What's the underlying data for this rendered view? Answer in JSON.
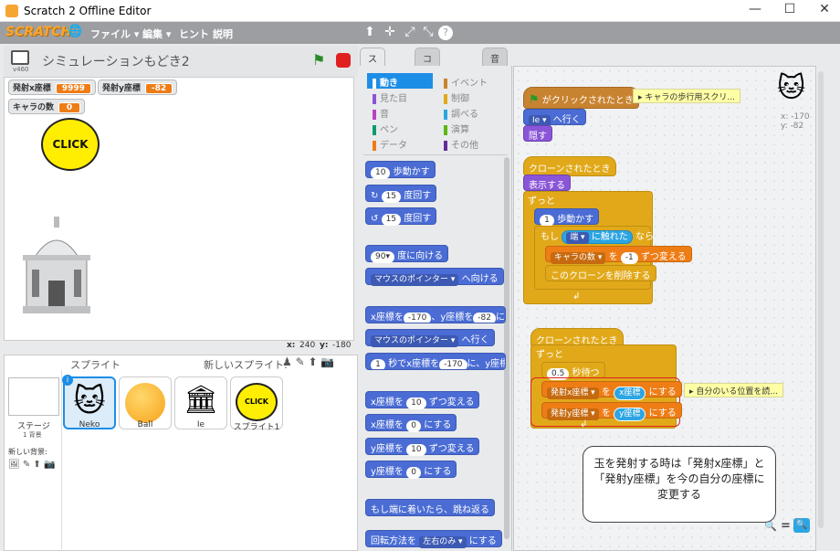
{
  "window": {
    "title": "Scratch 2 Offline Editor",
    "min": "—",
    "max": "☐",
    "close": "✕"
  },
  "menubar": {
    "logo": "SCRATCH",
    "items": [
      "ファイル ▾",
      "編集 ▾",
      "ヒント",
      "説明"
    ],
    "tools": [
      "⬆",
      "✛",
      "⤢",
      "⤡",
      "?"
    ]
  },
  "stage": {
    "title": "シミュレーションもどき2",
    "version": "v460",
    "monitors": [
      {
        "label": "発射x座標",
        "value": "9999"
      },
      {
        "label": "発射y座標",
        "value": "-82"
      },
      {
        "label": "キャラの数",
        "value": "0"
      }
    ],
    "click_text": "CLICK",
    "coords": {
      "x_label": "x:",
      "x": "240",
      "y_label": "y:",
      "y": "-180"
    }
  },
  "sprites": {
    "header": "スプライト",
    "new_label": "新しいスプライト:",
    "stage_label": "ステージ",
    "stage_sub": "1 背景",
    "new_bg": "新しい背景:",
    "items": [
      {
        "name": "Neko"
      },
      {
        "name": "Ball"
      },
      {
        "name": "Ie"
      },
      {
        "name": "スプライト1"
      }
    ]
  },
  "tabs": [
    "スクリプト",
    "コスチューム",
    "音"
  ],
  "categories": {
    "left": [
      {
        "label": "動き",
        "color": "#4a6cd4"
      },
      {
        "label": "見た目",
        "color": "#8a55d7"
      },
      {
        "label": "音",
        "color": "#bb42c3"
      },
      {
        "label": "ペン",
        "color": "#0e9a6c"
      },
      {
        "label": "データ",
        "color": "#ee7d16"
      }
    ],
    "right": [
      {
        "label": "イベント",
        "color": "#c88330"
      },
      {
        "label": "制御",
        "color": "#e1a91a"
      },
      {
        "label": "調べる",
        "color": "#2ca5e2"
      },
      {
        "label": "演算",
        "color": "#5cb712"
      },
      {
        "label": "その他",
        "color": "#632d99"
      }
    ]
  },
  "palette": {
    "move": {
      "n": "10",
      "t": "歩動かす"
    },
    "turn_r": {
      "n": "15",
      "t": "度回す"
    },
    "turn_l": {
      "n": "15",
      "t": "度回す"
    },
    "point": {
      "n": "90▾",
      "t": "度に向ける"
    },
    "toward": {
      "d": "マウスのポインター ▾",
      "t": "へ向ける"
    },
    "gotoxy": {
      "a": "x座標を",
      "x": "-170",
      "b": "、y座標を",
      "y": "-82",
      "c": "にす"
    },
    "goto": {
      "d": "マウスのポインター ▾",
      "t": "へ行く"
    },
    "glide": {
      "n": "1",
      "a": "秒でx座標を",
      "x": "-170",
      "b": "に、y座標を"
    },
    "changex": {
      "a": "x座標を",
      "n": "10",
      "b": "ずつ変える"
    },
    "setx": {
      "a": "x座標を",
      "n": "0",
      "b": "にする"
    },
    "changey": {
      "a": "y座標を",
      "n": "10",
      "b": "ずつ変える"
    },
    "sety": {
      "a": "y座標を",
      "n": "0",
      "b": "にする"
    },
    "bounce": "もし端に着いたら、跳ね返る",
    "rotstyle": {
      "a": "回転方法を",
      "d": "左右のみ ▾",
      "b": "にする"
    }
  },
  "script1": {
    "hat": "がクリックされたとき",
    "comment": "▸ キャラの歩行用スクリ...",
    "goto": "へ行く",
    "goto_t": "Ie ▾",
    "hide": "隠す"
  },
  "script2": {
    "hat": "クローンされたとき",
    "show": "表示する",
    "forever": "ずっと",
    "move_n": "1",
    "move_t": "歩動かす",
    "if_a": "もし",
    "if_t": "端 ▾",
    "if_b": "に触れた",
    "if_c": "なら",
    "change_v": "キャラの数 ▾",
    "change_a": "を",
    "change_n": "-1",
    "change_b": "ずつ変える",
    "delete": "このクローンを削除する"
  },
  "script3": {
    "hat": "クローンされたとき",
    "forever": "ずっと",
    "wait_n": "0.5",
    "wait_t": "秒待つ",
    "set1_v": "発射x座標 ▾",
    "set1_a": "を",
    "set1_r": "x座標",
    "set1_b": "にする",
    "set2_v": "発射y座標 ▾",
    "set2_a": "を",
    "set2_r": "y座標",
    "set2_b": "にする",
    "comment": "▸ 自分のいる位置を読..."
  },
  "sprite_info": {
    "x": "x: -170",
    "y": "y: -82"
  },
  "bubble": "玉を発射する時は「発射x座標」と「発射y座標」を今の自分の座標に変更する",
  "zoom": {
    "minus": "🔍",
    "eq": "=",
    "plus": "🔍"
  }
}
